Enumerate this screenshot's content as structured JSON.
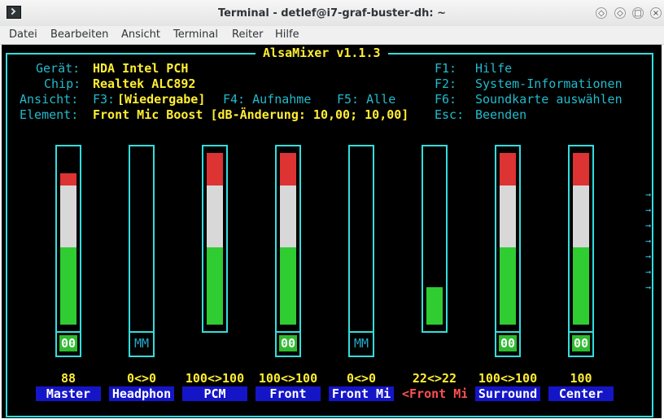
{
  "window": {
    "title": "Terminal - detlef@i7-graf-buster-dh: ~",
    "controls": [
      "◇",
      "◇",
      "□",
      "×"
    ]
  },
  "menubar": [
    "Datei",
    "Bearbeiten",
    "Ansicht",
    "Terminal",
    "Reiter",
    "Hilfe"
  ],
  "mixer": {
    "title": " AlsaMixer v1.1.3 ",
    "info": {
      "device_label": "Gerät:",
      "device_value": "HDA Intel PCH",
      "chip_label": "Chip:",
      "chip_value": "Realtek ALC892",
      "view_label": "Ansicht:",
      "view_f3": "F3:",
      "view_f3_value": "[Wiedergabe]",
      "view_f4": "F4: Aufnahme",
      "view_f5": "F5: Alle",
      "element_label": "Element:",
      "element_value": "Front Mic Boost [dB-Änderung: 10,00; 10,00]"
    },
    "keys": [
      {
        "key": "F1:",
        "desc": "Hilfe"
      },
      {
        "key": "F2:",
        "desc": "System-Informationen"
      },
      {
        "key": "F6:",
        "desc": "Soundkarte auswählen"
      },
      {
        "key": "Esc:",
        "desc": "Beenden"
      }
    ],
    "channels": [
      {
        "name": "Master",
        "value": "88",
        "level": 0.88,
        "switch": "00",
        "selected": false
      },
      {
        "name": "Headphon",
        "value": "0<>0",
        "level": 0,
        "switch": "MM",
        "selected": false
      },
      {
        "name": "PCM",
        "value": "100<>100",
        "level": 1.0,
        "switch": "",
        "selected": false
      },
      {
        "name": "Front",
        "value": "100<>100",
        "level": 1.0,
        "switch": "00",
        "selected": false
      },
      {
        "name": "Front Mi",
        "value": "0<>0",
        "level": 0,
        "switch": "MM",
        "selected": false
      },
      {
        "name": "<Front Mi>",
        "value": "22<>22",
        "level": 0.22,
        "switch": "",
        "selected": true
      },
      {
        "name": "Surround",
        "value": "100<>100",
        "level": 1.0,
        "switch": "00",
        "selected": false
      },
      {
        "name": "Center",
        "value": "100",
        "level": 1.0,
        "switch": "00",
        "selected": false
      }
    ],
    "more_arrow": "→"
  }
}
